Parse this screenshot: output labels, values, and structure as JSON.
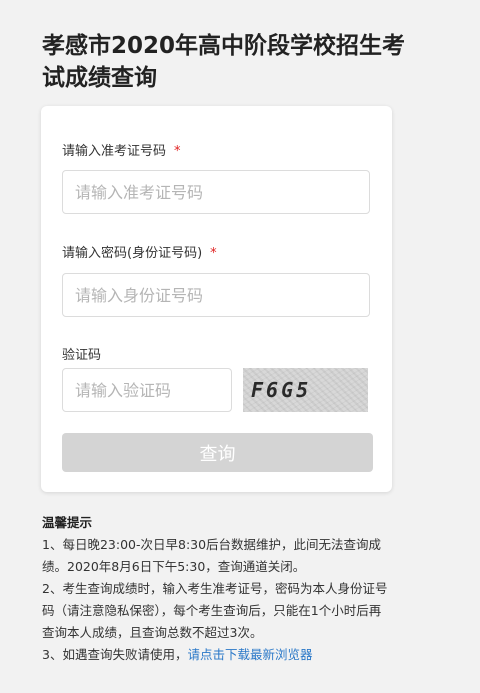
{
  "page": {
    "title": "孝感市2020年高中阶段学校招生考试成绩查询"
  },
  "form": {
    "exam_id": {
      "label": "请输入准考证号码",
      "required_mark": "*",
      "placeholder": "请输入准考证号码",
      "value": ""
    },
    "password": {
      "label": "请输入密码(身份证号码)",
      "required_mark": "*",
      "placeholder": "请输入身份证号码",
      "value": ""
    },
    "captcha": {
      "label": "验证码",
      "placeholder": "请输入验证码",
      "value": "",
      "image_text": "F6G5"
    },
    "submit_label": "查询"
  },
  "tips": {
    "title": "温馨提示",
    "line1": "1、每日晚23:00-次日早8:30后台数据维护，此间无法查询成绩。2020年8月6日下午5:30，查询通道关闭。",
    "line2": "2、考生查询成绩时，输入考生准考证号，密码为本人身份证号码（请注意隐私保密），每个考生查询后，只能在1个小时后再查询本人成绩，且查询总数不超过3次。",
    "line3_prefix": "3、如遇查询失败请使用，",
    "line3_link": "请点击下载最新浏览器"
  },
  "colors": {
    "required": "#e02020",
    "link": "#2a78c8",
    "submit_bg": "#d4d4d4"
  }
}
